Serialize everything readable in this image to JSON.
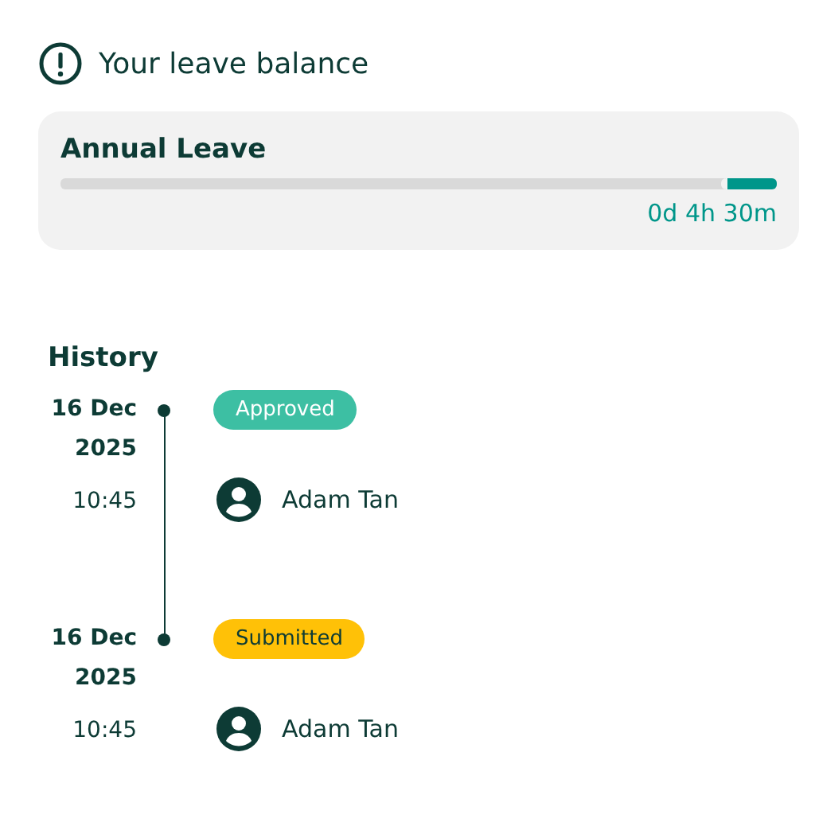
{
  "header": {
    "title": "Your leave balance"
  },
  "balance": {
    "name": "Annual Leave",
    "level": 0.07,
    "reading": "0d 4h 30m"
  },
  "history": {
    "title": "History",
    "entries": [
      {
        "date": "16 Dec",
        "year": "2025",
        "time": "10:45",
        "status": "Approved",
        "kind": "approved",
        "person": "Adam Tan"
      },
      {
        "date": "16 Dec",
        "year": "2025",
        "time": "10:45",
        "status": "Submitted",
        "kind": "submitted",
        "person": "Adam Tan"
      }
    ]
  }
}
